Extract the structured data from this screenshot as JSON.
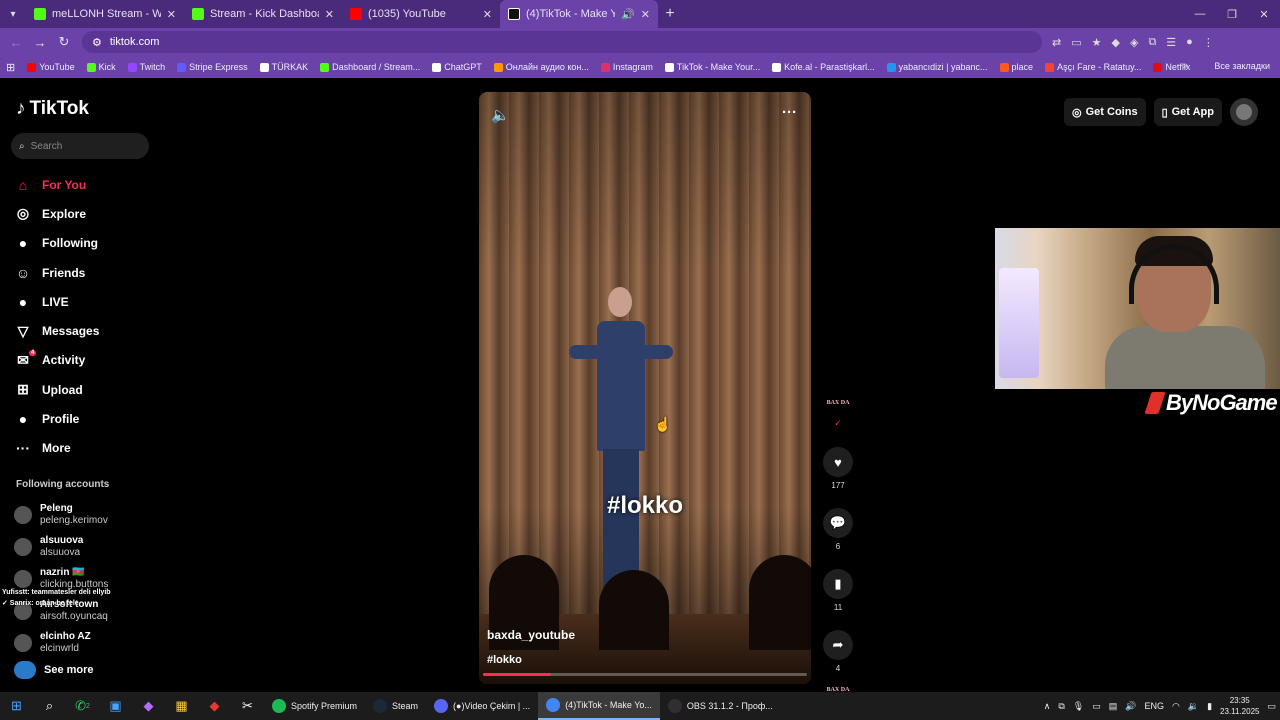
{
  "browser": {
    "tabs": [
      {
        "title": "meLLONH Stream - Watch Live",
        "color": "#53fc18",
        "active": false
      },
      {
        "title": "Stream - Kick Dashboard",
        "color": "#53fc18",
        "active": false
      },
      {
        "title": "(1035) YouTube",
        "color": "#ff0000",
        "active": false
      },
      {
        "title": "(4)TikTok - Make Your Day",
        "color": "#ffffff",
        "active": true
      }
    ],
    "url": "tiktok.com",
    "bookmarks": [
      {
        "label": "YouTube",
        "color": "#ff0000"
      },
      {
        "label": "Kick",
        "color": "#53fc18"
      },
      {
        "label": "Twitch",
        "color": "#9146ff"
      },
      {
        "label": "Stripe Express",
        "color": "#635bff"
      },
      {
        "label": "TÜRKAK",
        "color": "#ffffff"
      },
      {
        "label": "Dashboard / Stream...",
        "color": "#53fc18"
      },
      {
        "label": "ChatGPT",
        "color": "#ffffff"
      },
      {
        "label": "Онлайн аудио кон...",
        "color": "#ff9800"
      },
      {
        "label": "Instagram",
        "color": "#e1306c"
      },
      {
        "label": "TikTok - Make Your...",
        "color": "#ffffff"
      },
      {
        "label": "Kofe.al - Parastişkarl...",
        "color": "#ffffff"
      },
      {
        "label": "yabancıdizi | yabanc...",
        "color": "#2196f3"
      },
      {
        "label": "place",
        "color": "#ff5722"
      },
      {
        "label": "Aşçı Fare - Ratatuy...",
        "color": "#f44336"
      },
      {
        "label": "Netflix",
        "color": "#e50914"
      }
    ],
    "bookmarks_more": "»",
    "all_bookmarks": "Все закладки"
  },
  "tiktok": {
    "logo": "TikTok",
    "search_placeholder": "Search",
    "nav": [
      {
        "label": "For You",
        "icon": "home-icon",
        "glyph": "⌂",
        "active": true
      },
      {
        "label": "Explore",
        "icon": "compass-icon",
        "glyph": "◎",
        "active": false
      },
      {
        "label": "Following",
        "icon": "following-avatar-icon",
        "glyph": "●",
        "active": false
      },
      {
        "label": "Friends",
        "icon": "friends-icon",
        "glyph": "☺",
        "active": false
      },
      {
        "label": "LIVE",
        "icon": "live-avatar-icon",
        "glyph": "●",
        "active": false
      },
      {
        "label": "Messages",
        "icon": "messages-icon",
        "glyph": "▽",
        "active": false
      },
      {
        "label": "Activity",
        "icon": "activity-icon",
        "glyph": "✉",
        "active": false
      },
      {
        "label": "Upload",
        "icon": "upload-icon",
        "glyph": "⊞",
        "active": false
      },
      {
        "label": "Profile",
        "icon": "profile-avatar-icon",
        "glyph": "●",
        "active": false
      },
      {
        "label": "More",
        "icon": "more-icon",
        "glyph": "···",
        "active": false
      }
    ],
    "activity_badge": "4",
    "following_title": "Following accounts",
    "following": [
      {
        "name": "Peleng",
        "handle": "peleng.kerimov"
      },
      {
        "name": "alsuuova",
        "handle": "alsuuova"
      },
      {
        "name": "nazrin 🇦🇿",
        "handle": "clicking.buttons"
      },
      {
        "name": "Airsoft town",
        "handle": "airsoft.oyuncaq"
      },
      {
        "name": "elcinho AZ",
        "handle": "elcinwrld"
      }
    ],
    "see_more": "See more",
    "chat_overlay": [
      "Yufisstt: teammatesler deli ellyib",
      "✓ Sanrix: oraan be tele"
    ],
    "top_right": {
      "coins": "Get Coins",
      "app": "Get App"
    },
    "video": {
      "overlay_text": "#lokko",
      "author": "baxda_youtube",
      "caption": "#lokko",
      "progress": 0.21,
      "creator_badge": "BAX DA",
      "likes": "177",
      "comments": "6",
      "saves": "11",
      "shares": "4"
    }
  },
  "stream_overlay": {
    "brand": "ByNoGame"
  },
  "taskbar": {
    "apps": [
      {
        "label": "Spotify Premium",
        "color": "#1db954",
        "active": false
      },
      {
        "label": "Steam",
        "color": "#1b2838",
        "active": false
      },
      {
        "label": "(●)Video Çekim | ...",
        "color": "#5865f2",
        "active": false
      },
      {
        "label": "(4)TikTok - Make Yo...",
        "color": "#4285f4",
        "active": true
      },
      {
        "label": "OBS 31.1.2 - Проф...",
        "color": "#302e31",
        "active": false
      }
    ],
    "whatsapp_badge": "2",
    "lang": "ENG",
    "time": "23:35",
    "date": "23.11.2025"
  }
}
